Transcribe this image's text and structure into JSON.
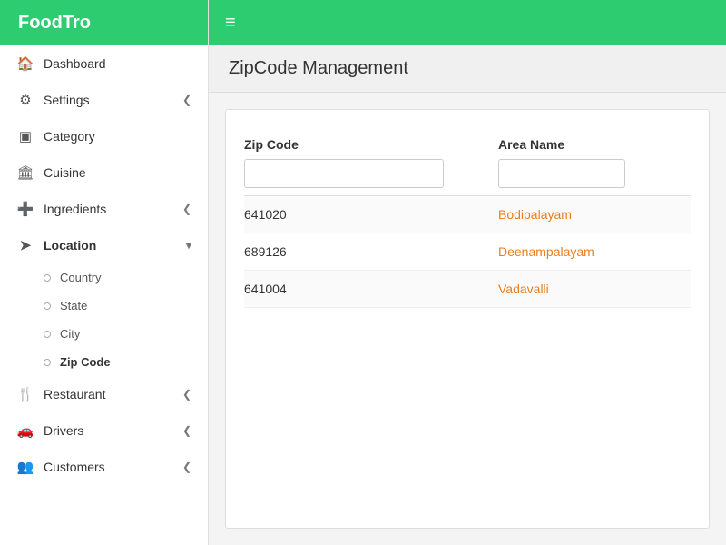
{
  "brand": "FoodTro",
  "topbar": {
    "hamburger": "≡"
  },
  "page_title": "ZipCode Management",
  "sidebar": {
    "items": [
      {
        "id": "dashboard",
        "label": "Dashboard",
        "icon": "🏠",
        "arrow": ""
      },
      {
        "id": "settings",
        "label": "Settings",
        "icon": "⚙",
        "arrow": "❮"
      },
      {
        "id": "category",
        "label": "Category",
        "icon": "▣",
        "arrow": ""
      },
      {
        "id": "cuisine",
        "label": "Cuisine",
        "icon": "🏛",
        "arrow": ""
      },
      {
        "id": "ingredients",
        "label": "Ingredients",
        "icon": "➕",
        "arrow": "❮"
      },
      {
        "id": "location",
        "label": "Location",
        "icon": "➤",
        "arrow": "▾",
        "expanded": true
      },
      {
        "id": "restaurant",
        "label": "Restaurant",
        "icon": "🍴",
        "arrow": "❮"
      },
      {
        "id": "drivers",
        "label": "Drivers",
        "icon": "🚗",
        "arrow": "❮"
      },
      {
        "id": "customers",
        "label": "Customers",
        "icon": "👥",
        "arrow": "❮"
      }
    ],
    "location_sub": [
      {
        "id": "country",
        "label": "Country"
      },
      {
        "id": "state",
        "label": "State"
      },
      {
        "id": "city",
        "label": "City"
      },
      {
        "id": "zipcode",
        "label": "Zip Code",
        "active": true
      }
    ]
  },
  "table": {
    "col1_header": "Zip Code",
    "col2_header": "Area Name",
    "col1_filter_placeholder": "",
    "col2_filter_placeholder": "",
    "rows": [
      {
        "zipcode": "641020",
        "areaname": "Bodipalayam"
      },
      {
        "zipcode": "689126",
        "areaname": "Deenampalayam"
      },
      {
        "zipcode": "641004",
        "areaname": "Vadavalli"
      }
    ]
  }
}
